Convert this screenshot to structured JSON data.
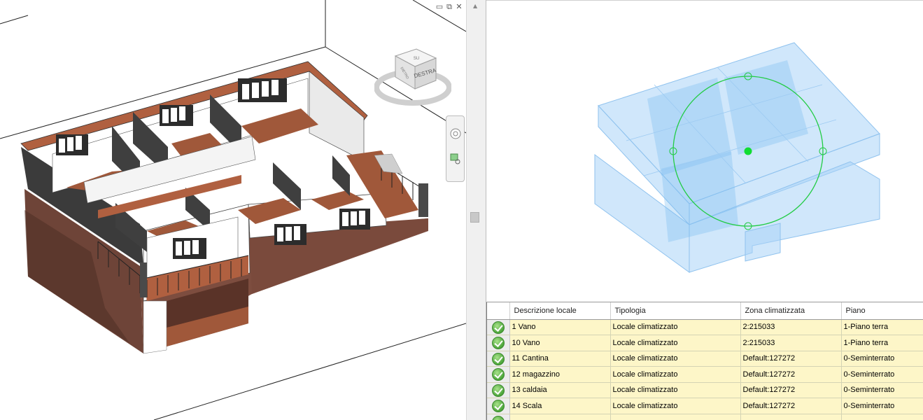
{
  "viewcube": {
    "face_label": "DESTRA",
    "top_label": "SU",
    "side_label": "DIETRO"
  },
  "window_controls": {
    "minimize": "▭",
    "restore": "⧉",
    "close": "✕"
  },
  "splitter": {
    "arrow": "▲"
  },
  "grid": {
    "columns": [
      "",
      "Descrizione locale",
      "Tipologia",
      "Zona climatizzata",
      "Piano"
    ],
    "rows": [
      {
        "status": "ok",
        "descrizione": "1 Vano",
        "tipologia": "Locale climatizzato",
        "zona": "2:215033",
        "piano": "1-Piano terra"
      },
      {
        "status": "ok",
        "descrizione": "10 Vano",
        "tipologia": "Locale climatizzato",
        "zona": "2:215033",
        "piano": "1-Piano terra"
      },
      {
        "status": "ok",
        "descrizione": "11 Cantina",
        "tipologia": "Locale climatizzato",
        "zona": "Default:127272",
        "piano": "0-Seminterrato"
      },
      {
        "status": "ok",
        "descrizione": "12 magazzino",
        "tipologia": "Locale climatizzato",
        "zona": "Default:127272",
        "piano": "0-Seminterrato"
      },
      {
        "status": "ok",
        "descrizione": "13 caldaia",
        "tipologia": "Locale climatizzato",
        "zona": "Default:127272",
        "piano": "0-Seminterrato"
      },
      {
        "status": "ok",
        "descrizione": "14 Scala",
        "tipologia": "Locale climatizzato",
        "zona": "Default:127272",
        "piano": "0-Seminterrato"
      }
    ]
  },
  "colors": {
    "row_bg": "#fdf6c8",
    "check_green": "#4ca53a",
    "volume_blue": "#a9d3f7",
    "gizmo_green": "#22cc44",
    "floor_wood": "#a0583a",
    "brick": "#6e4438"
  }
}
